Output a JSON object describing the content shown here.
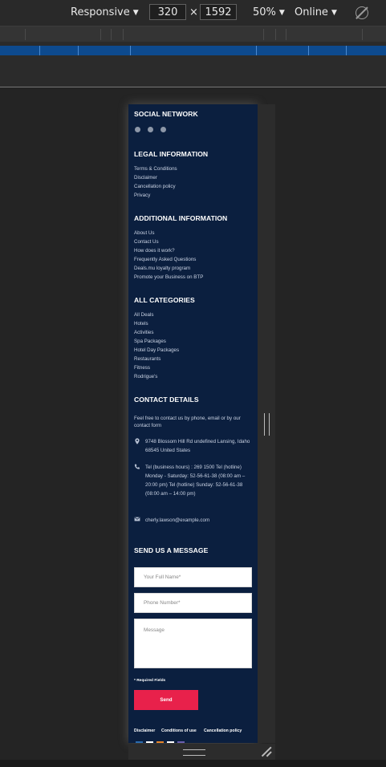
{
  "devtools": {
    "device": "Responsive",
    "width": "320",
    "times": "×",
    "height": "1592",
    "zoom": "50%",
    "throttle": "Online"
  },
  "site": {
    "social": {
      "title": "SOCIAL NETWORK",
      "icons": [
        "facebook-icon",
        "youtube-icon",
        "x-icon"
      ]
    },
    "legal": {
      "title": "LEGAL INFORMATION",
      "items": [
        "Terms & Conditions",
        "Disclaimer",
        "Cancellation policy",
        "Privacy"
      ]
    },
    "additional": {
      "title": "ADDITIONAL INFORMATION",
      "items": [
        "About Us",
        "Contact Us",
        "How does it work?",
        "Frequently Asked Questions",
        "Deals.mu loyalty program",
        "Promote your Business on BTP"
      ]
    },
    "categories": {
      "title": "ALL CATEGORIES",
      "items": [
        "All Deals",
        "Hotels",
        "Activities",
        "Spa Packages",
        "Hotel Day Packages",
        "Restaurants",
        "Fitness",
        "Rodrigue's"
      ]
    },
    "contact": {
      "title": "CONTACT DETAILS",
      "intro": "Feel free to contact us by phone, email or by our contact form",
      "address": "9748 Blossom Hill Rd undefined Lansing, Idaho 68545 United States",
      "phone": "Tel (business hours) : 269 1500 Tel (hotline) Monday - Saturday: 52-56-61-38 (08:00 am – 20:00 pm) Tel (hotline) Sunday: 52-56-61-38 (08:00 am – 14:00 pm)",
      "email": "cherly.lawson@example.com"
    },
    "message": {
      "title": "SEND US A MESSAGE",
      "name_placeholder": "Your Full Name*",
      "phone_placeholder": "Phone Number*",
      "message_placeholder": "Message",
      "required_note": "* Required Fields",
      "send_label": "Send"
    },
    "footer": {
      "links": [
        "Disclaimer",
        "Conditions of use",
        "Cancellation policy"
      ]
    },
    "colors": {
      "background": "#0b1f3f",
      "accent": "#e8214b"
    }
  }
}
